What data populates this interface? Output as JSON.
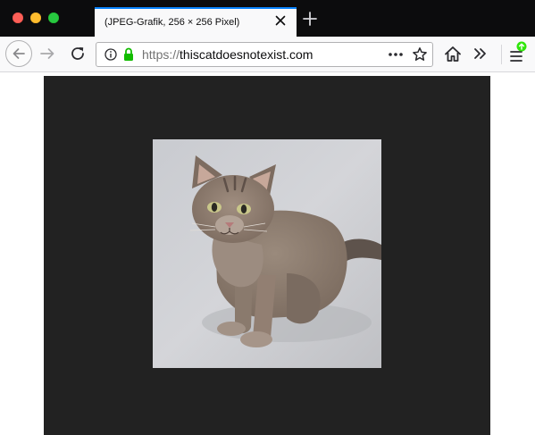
{
  "tab": {
    "title": "(JPEG-Grafik, 256 × 256 Pixel)"
  },
  "urlbar": {
    "protocol": "https://",
    "host": "thiscatdoesnotexist.com"
  },
  "image": {
    "description_icon": "cat-photo-image",
    "width": 256,
    "height": 256
  },
  "colors": {
    "tab_accent": "#0a84ff",
    "lock_green": "#12bc00",
    "viewer_background": "#222222",
    "tabstrip_background": "#0c0c0d",
    "update_badge": "#30e60b"
  },
  "icons": {
    "back": "back-arrow-icon",
    "forward": "forward-arrow-icon",
    "reload": "reload-icon",
    "info": "info-icon",
    "lock": "lock-icon",
    "more": "more-dots-icon",
    "bookmark": "star-icon",
    "home": "home-icon",
    "overflow": "double-chevron-icon",
    "menu": "hamburger-icon",
    "close_tab": "close-icon",
    "new_tab": "plus-icon"
  }
}
